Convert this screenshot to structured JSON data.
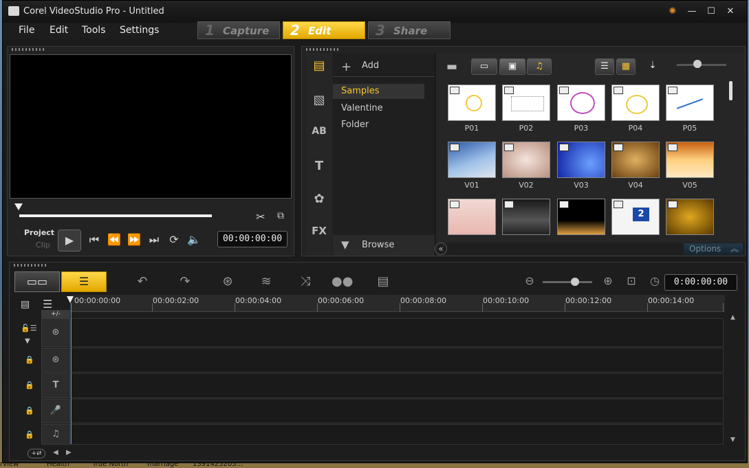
{
  "window": {
    "title": "Corel VideoStudio Pro - Untitled"
  },
  "menus": [
    "File",
    "Edit",
    "Tools",
    "Settings"
  ],
  "steps": [
    {
      "num": "1",
      "label": "Capture",
      "active": false
    },
    {
      "num": "2",
      "label": "Edit",
      "active": true
    },
    {
      "num": "3",
      "label": "Share",
      "active": false
    }
  ],
  "player": {
    "project_label": "Project",
    "clip_label": "Clip",
    "timecode": "00:00:00:00"
  },
  "library": {
    "add_label": "Add",
    "folders": [
      "Samples",
      "Valentine",
      "Folder"
    ],
    "browse_label": "Browse",
    "options_label": "Options",
    "thumbs_row1": [
      "P01",
      "P02",
      "P03",
      "P04",
      "P05"
    ],
    "thumbs_row2": [
      "V01",
      "V02",
      "V03",
      "V04",
      "V05"
    ],
    "thumbs_row3": [
      "",
      "",
      "",
      "",
      ""
    ]
  },
  "timeline": {
    "timecode": "0:00:00:00",
    "ruler": [
      "00:00:00:00",
      "00:00:02:00",
      "00:00:04:00",
      "00:00:06:00",
      "00:00:08:00",
      "00:00:10:00",
      "00:00:12:00",
      "00:00:14:00"
    ],
    "track_controls": "+/-"
  },
  "taskbar": [
    "rview",
    "Health",
    "True North",
    "marriage",
    "1391425205..."
  ],
  "colors": {
    "accent": "#f6c431",
    "background": "#1b1b1b"
  }
}
